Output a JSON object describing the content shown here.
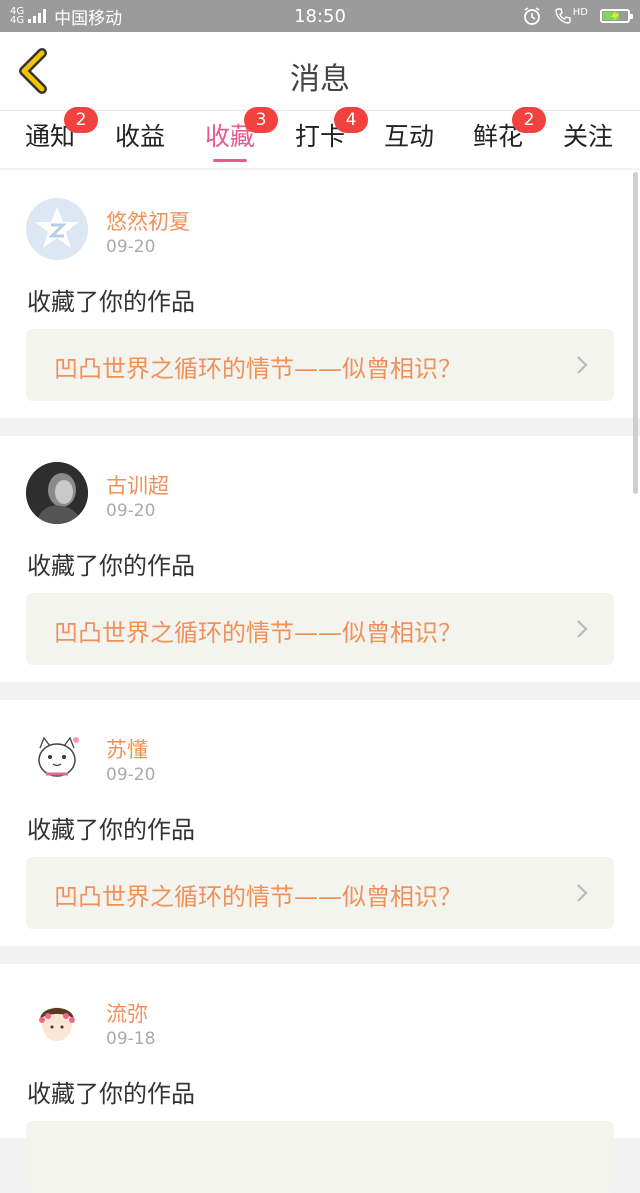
{
  "status_bar": {
    "network": "4G",
    "network2": "4G",
    "carrier": "中国移动",
    "time": "18:50",
    "hd": "HD"
  },
  "header": {
    "title": "消息"
  },
  "tabs": [
    {
      "label": "通知",
      "badge": "2",
      "active": false
    },
    {
      "label": "收益",
      "badge": "",
      "active": false
    },
    {
      "label": "收藏",
      "badge": "3",
      "active": true
    },
    {
      "label": "打卡",
      "badge": "4",
      "active": false
    },
    {
      "label": "互动",
      "badge": "",
      "active": false
    },
    {
      "label": "鲜花",
      "badge": "2",
      "active": false
    },
    {
      "label": "关注",
      "badge": "",
      "active": false
    }
  ],
  "messages": [
    {
      "user": "悠然初夏",
      "date": "09-20",
      "action": "收藏了你的作品",
      "work": "凹凸世界之循环的情节——似曾相识？"
    },
    {
      "user": "古训超",
      "date": "09-20",
      "action": "收藏了你的作品",
      "work": "凹凸世界之循环的情节——似曾相识？"
    },
    {
      "user": "苏懂",
      "date": "09-20",
      "action": "收藏了你的作品",
      "work": "凹凸世界之循环的情节——似曾相识？"
    },
    {
      "user": "流弥",
      "date": "09-18",
      "action": "收藏了你的作品",
      "work": ""
    }
  ],
  "colors": {
    "accent": "#e65b8e",
    "username": "#f0915a",
    "badge": "#f2413e",
    "back_icon": "#f5c400"
  }
}
